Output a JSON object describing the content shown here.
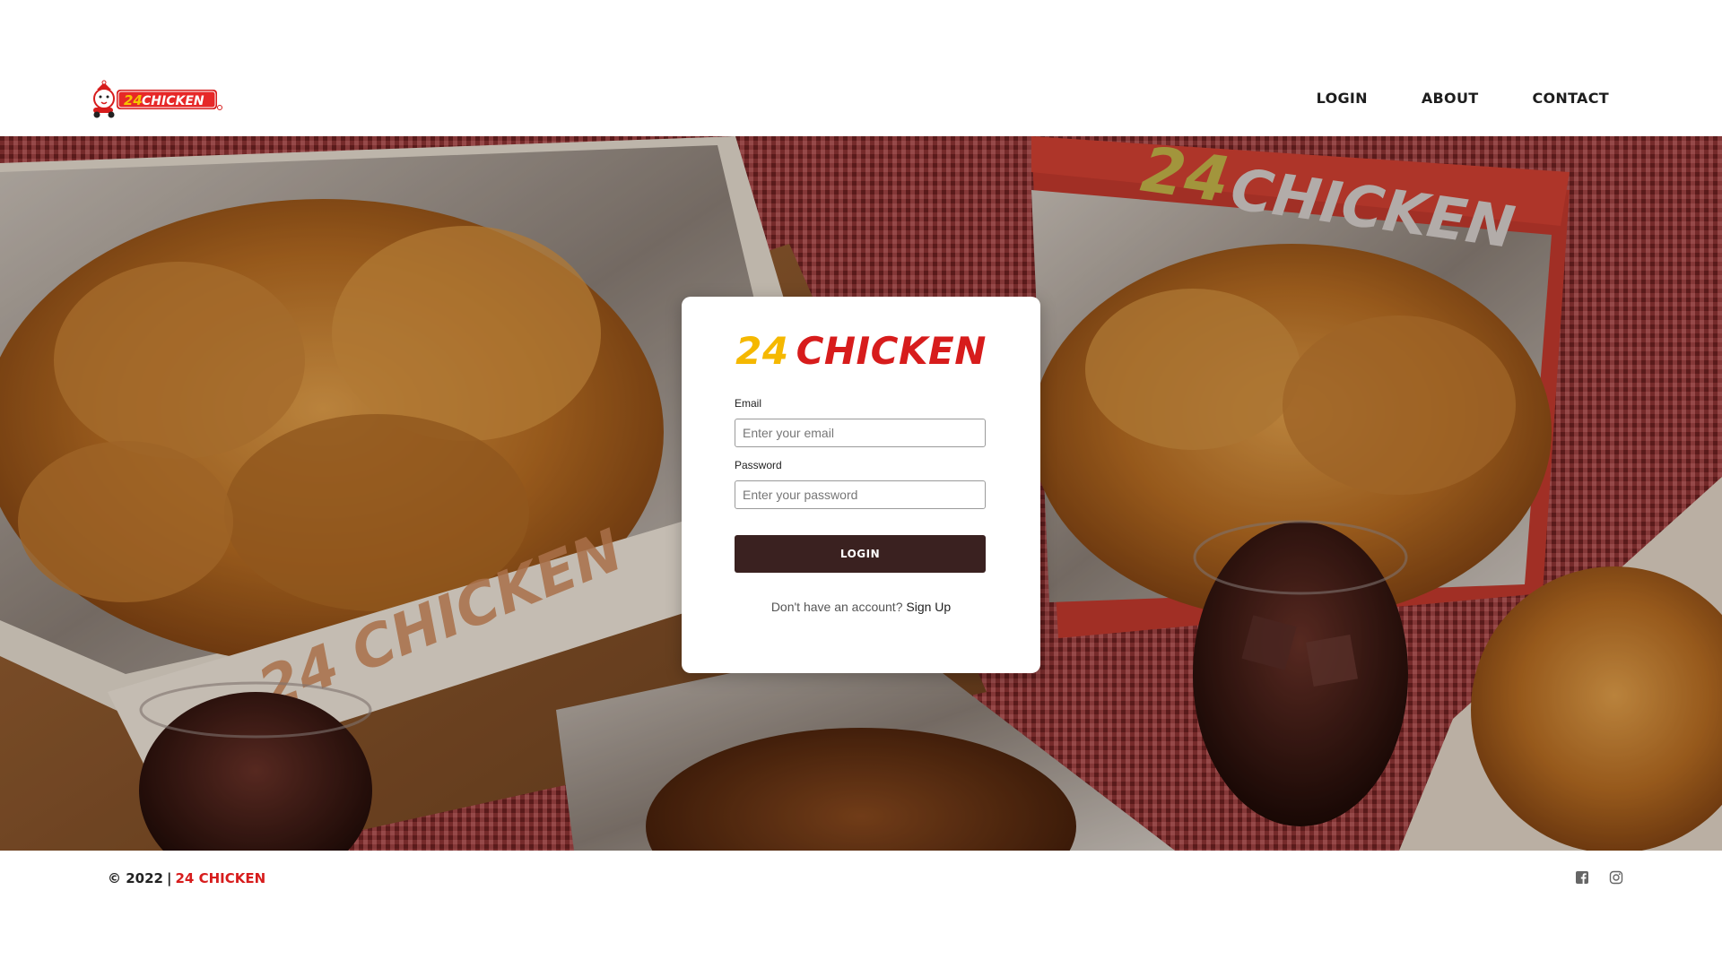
{
  "header": {
    "logo_text": "24CHICKEN",
    "nav": [
      {
        "label": "LOGIN"
      },
      {
        "label": "ABOUT"
      },
      {
        "label": "CONTACT"
      }
    ]
  },
  "hero": {
    "box_text_left": "24 CHICKEN",
    "box_text_right_num": "24",
    "box_text_right_word": "CHICKEN"
  },
  "login_card": {
    "brand_num": "24",
    "brand_word": "CHICKEN",
    "email_label": "Email",
    "email_placeholder": "Enter your email",
    "password_label": "Password",
    "password_placeholder": "Enter your password",
    "submit_label": "LOGIN",
    "signup_prompt": "Don't have an account?",
    "signup_link": "Sign Up"
  },
  "footer": {
    "copyright": "© 2022",
    "separator": "|",
    "brand": "24 CHICKEN",
    "social": [
      {
        "icon": "facebook-icon"
      },
      {
        "icon": "instagram-icon"
      }
    ]
  },
  "colors": {
    "brand_red": "#d71c1c",
    "brand_yellow": "#f5b800",
    "button_dark": "#3a2120"
  }
}
